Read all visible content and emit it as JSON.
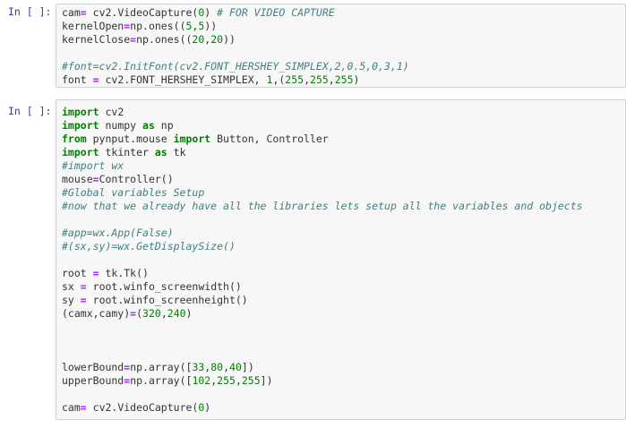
{
  "cells": [
    {
      "prompt": "In [ ]:",
      "lines": [
        [
          [
            "n",
            "cam"
          ],
          [
            "op",
            "="
          ],
          [
            "n",
            " cv2.VideoCapture("
          ],
          [
            "num",
            "0"
          ],
          [
            "n",
            ") "
          ],
          [
            "cm",
            "# FOR VIDEO CAPTURE"
          ]
        ],
        [
          [
            "n",
            "kernelOpen"
          ],
          [
            "op",
            "="
          ],
          [
            "n",
            "np.ones(("
          ],
          [
            "num",
            "5"
          ],
          [
            "n",
            ","
          ],
          [
            "num",
            "5"
          ],
          [
            "n",
            "))"
          ]
        ],
        [
          [
            "n",
            "kernelClose"
          ],
          [
            "op",
            "="
          ],
          [
            "n",
            "np.ones(("
          ],
          [
            "num",
            "20"
          ],
          [
            "n",
            ","
          ],
          [
            "num",
            "20"
          ],
          [
            "n",
            "))"
          ]
        ],
        [],
        [
          [
            "cm",
            "#font=cv2.InitFont(cv2.FONT_HERSHEY_SIMPLEX,2,0.5,0,3,1)"
          ]
        ],
        [
          [
            "n",
            "font "
          ],
          [
            "op",
            "="
          ],
          [
            "n",
            " cv2.FONT_HERSHEY_SIMPLEX, "
          ],
          [
            "num",
            "1"
          ],
          [
            "n",
            ",("
          ],
          [
            "num",
            "255"
          ],
          [
            "n",
            ","
          ],
          [
            "num",
            "255"
          ],
          [
            "n",
            ","
          ],
          [
            "num",
            "255"
          ],
          [
            "n",
            ")"
          ]
        ]
      ]
    },
    {
      "prompt": "In [ ]:",
      "lines": [
        [
          [
            "kw",
            "import"
          ],
          [
            "n",
            " cv2"
          ]
        ],
        [
          [
            "kw",
            "import"
          ],
          [
            "n",
            " numpy "
          ],
          [
            "kw",
            "as"
          ],
          [
            "n",
            " np"
          ]
        ],
        [
          [
            "kw",
            "from"
          ],
          [
            "n",
            " pynput.mouse "
          ],
          [
            "kw",
            "import"
          ],
          [
            "n",
            " Button, Controller"
          ]
        ],
        [
          [
            "kw",
            "import"
          ],
          [
            "n",
            " tkinter "
          ],
          [
            "kw",
            "as"
          ],
          [
            "n",
            " tk"
          ]
        ],
        [
          [
            "cm",
            "#import wx"
          ]
        ],
        [
          [
            "n",
            "mouse"
          ],
          [
            "op",
            "="
          ],
          [
            "n",
            "Controller()"
          ]
        ],
        [
          [
            "cm",
            "#Global variables Setup"
          ]
        ],
        [
          [
            "cm",
            "#now that we already have all the libraries lets setup all the variables and objects"
          ]
        ],
        [],
        [
          [
            "cm",
            "#app=wx.App(False)"
          ]
        ],
        [
          [
            "cm",
            "#(sx,sy)=wx.GetDisplaySize()"
          ]
        ],
        [],
        [
          [
            "n",
            "root "
          ],
          [
            "op",
            "="
          ],
          [
            "n",
            " tk.Tk()"
          ]
        ],
        [
          [
            "n",
            "sx "
          ],
          [
            "op",
            "="
          ],
          [
            "n",
            " root.winfo_screenwidth()"
          ]
        ],
        [
          [
            "n",
            "sy "
          ],
          [
            "op",
            "="
          ],
          [
            "n",
            " root.winfo_screenheight()"
          ]
        ],
        [
          [
            "n",
            "(camx,camy)"
          ],
          [
            "op",
            "="
          ],
          [
            "n",
            "("
          ],
          [
            "num",
            "320"
          ],
          [
            "n",
            ","
          ],
          [
            "num",
            "240"
          ],
          [
            "n",
            ")"
          ]
        ],
        [],
        [],
        [],
        [
          [
            "n",
            "lowerBound"
          ],
          [
            "op",
            "="
          ],
          [
            "n",
            "np.array(["
          ],
          [
            "num",
            "33"
          ],
          [
            "n",
            ","
          ],
          [
            "num",
            "80"
          ],
          [
            "n",
            ","
          ],
          [
            "num",
            "40"
          ],
          [
            "n",
            "])"
          ]
        ],
        [
          [
            "n",
            "upperBound"
          ],
          [
            "op",
            "="
          ],
          [
            "n",
            "np.array(["
          ],
          [
            "num",
            "102"
          ],
          [
            "n",
            ","
          ],
          [
            "num",
            "255"
          ],
          [
            "n",
            ","
          ],
          [
            "num",
            "255"
          ],
          [
            "n",
            "])"
          ]
        ],
        [],
        [
          [
            "n",
            "cam"
          ],
          [
            "op",
            "="
          ],
          [
            "n",
            " cv2.VideoCapture("
          ],
          [
            "num",
            "0"
          ],
          [
            "n",
            ")"
          ]
        ]
      ]
    }
  ]
}
